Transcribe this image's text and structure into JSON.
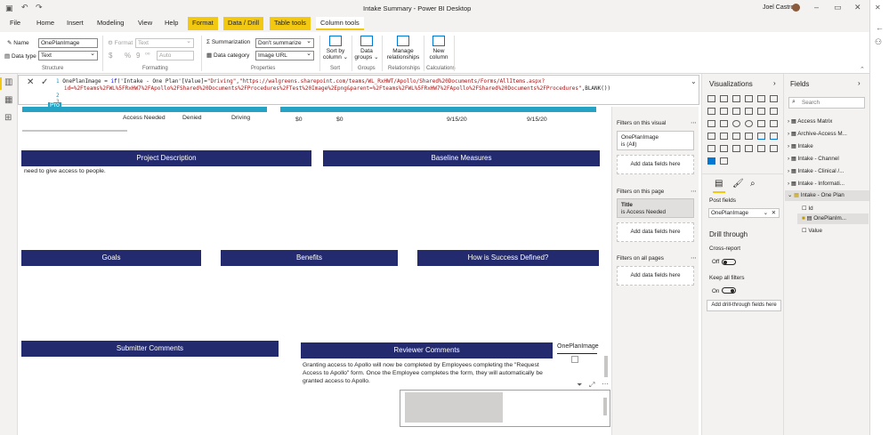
{
  "window": {
    "title": "Intake Summary - Power BI Desktop",
    "user": "Joel Castro"
  },
  "ribbon_tabs": [
    "File",
    "Home",
    "Insert",
    "Modeling",
    "View",
    "Help",
    "Format",
    "Data / Drill",
    "Table tools",
    "Column tools"
  ],
  "structure": {
    "name_label": "Name",
    "name_value": "OnePlanImage",
    "datatype_label": "Data type",
    "datatype_value": "Text",
    "group_label": "Structure"
  },
  "formatting": {
    "format_label": "Format",
    "format_value": "Text",
    "currency": "$",
    "percent": "%",
    "comma": "9",
    "decimals": "Auto",
    "group_label": "Formatting"
  },
  "properties": {
    "summarization_label": "Summarization",
    "summarization_value": "Don't summarize",
    "category_label": "Data category",
    "category_value": "Image URL",
    "group_label": "Properties"
  },
  "sort": {
    "button": "Sort by column",
    "line1": "Sort by",
    "line2": "column",
    "group_label": "Sort"
  },
  "groups": {
    "line1": "Data",
    "line2": "groups",
    "group_label": "Groups"
  },
  "relationships": {
    "line1": "Manage",
    "line2": "relationships",
    "group_label": "Relationships"
  },
  "calculations": {
    "line1": "New",
    "line2": "column",
    "group_label": "Calculations"
  },
  "formula": {
    "line1_num": "1",
    "line1_a": "OnePlanImage = ",
    "line1_if": "if",
    "line1_b": "('Intake - One Plan'[Value]=",
    "line1_s1": "\"Driving\"",
    "line1_c": ",",
    "line1_s2": "\"https://walgreens.sharepoint.com/teams/WL_RxHWT/Apollo/Shared%20Documents/Forms/AllItems.aspx?",
    "line1b": "id=%2Fteams%2FWL%5FRxHW7%2FApollo%2FShared%20Documents%2FProcedures%2FTest%20Image%2Epng&parent=%2Fteams%2FWL%5FRxHW7%2FApollo%2FShared%20Documents%2FProcedures\"",
    "line1b_tail": ",BLANK())",
    "line2_num": "2",
    "line3_num": "3"
  },
  "canvas": {
    "table_row": [
      "Access Needed",
      "Denied",
      "Driving",
      "$0",
      "$0",
      "9/15/20",
      "9/15/20"
    ],
    "headers": [
      "Project Description",
      "Baseline Measures",
      "Goals",
      "Benefits",
      "How is Success Defined?",
      "Submitter Comments",
      "Reviewer Comments"
    ],
    "project_desc_text": "need to give access to people.",
    "reviewer_text": "Granting access to Apollo will now be completed by Employees completing the \"Request Access to Apollo\" form. Once the Employee completes the form, they will automatically be granted access to Apollo.",
    "image_visual_label": "OnePlanImage",
    "partial_label": "Pro"
  },
  "filters": {
    "on_visual": "Filters on this visual",
    "card1_title": "OnePlanImage",
    "card1_value": "is (All)",
    "add_fields": "Add data fields here",
    "on_page": "Filters on this page",
    "card2_title": "Title",
    "card2_value": "is Access Needed",
    "on_all_pages": "Filters on all pages"
  },
  "visualizations": {
    "title": "Visualizations",
    "post_fields": "Post fields",
    "post_field_value": "OnePlanImage",
    "drill_through": "Drill through",
    "cross_report": "Cross-report",
    "cross_report_state": "Off",
    "keep_filters": "Keep all filters",
    "keep_filters_state": "On",
    "add_drill": "Add drill-through fields here"
  },
  "fields_pane": {
    "title": "Fields",
    "search_placeholder": "Search",
    "tables": [
      "Access Matrix",
      "Archive-Access M...",
      "Intake",
      "Intake - Channel",
      "Intake - Clinical /...",
      "Intake - Informati...",
      "Intake - One Plan"
    ],
    "one_plan_fields": [
      "Id",
      "OnePlanIm...",
      "Value"
    ]
  },
  "colors": {
    "header_navy": "#232a6e",
    "teal_table": "#25a3c4",
    "accent_yellow": "#f2c811"
  }
}
